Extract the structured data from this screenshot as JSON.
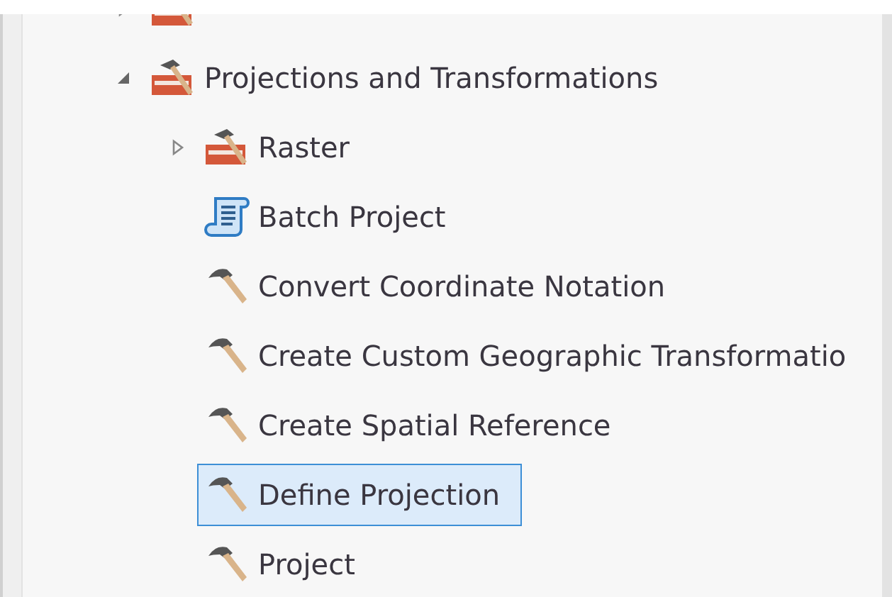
{
  "tree": {
    "items": [
      {
        "kind": "toolbox",
        "expanded": false,
        "selected": false
      },
      {
        "label": "Projections and Transformations",
        "kind": "toolbox",
        "expanded": true,
        "selected": false,
        "children": [
          {
            "label": "Raster",
            "kind": "toolbox",
            "expanded": false,
            "selected": false
          },
          {
            "label": "Batch Project",
            "kind": "script",
            "selected": false
          },
          {
            "label": "Convert Coordinate Notation",
            "kind": "tool",
            "selected": false
          },
          {
            "label": "Create Custom Geographic Transformatio",
            "kind": "tool",
            "selected": false
          },
          {
            "label": "Create Spatial Reference",
            "kind": "tool",
            "selected": false
          },
          {
            "label": "Define Projection",
            "kind": "tool",
            "selected": true
          },
          {
            "label": "Project",
            "kind": "tool",
            "selected": false
          }
        ]
      }
    ]
  }
}
